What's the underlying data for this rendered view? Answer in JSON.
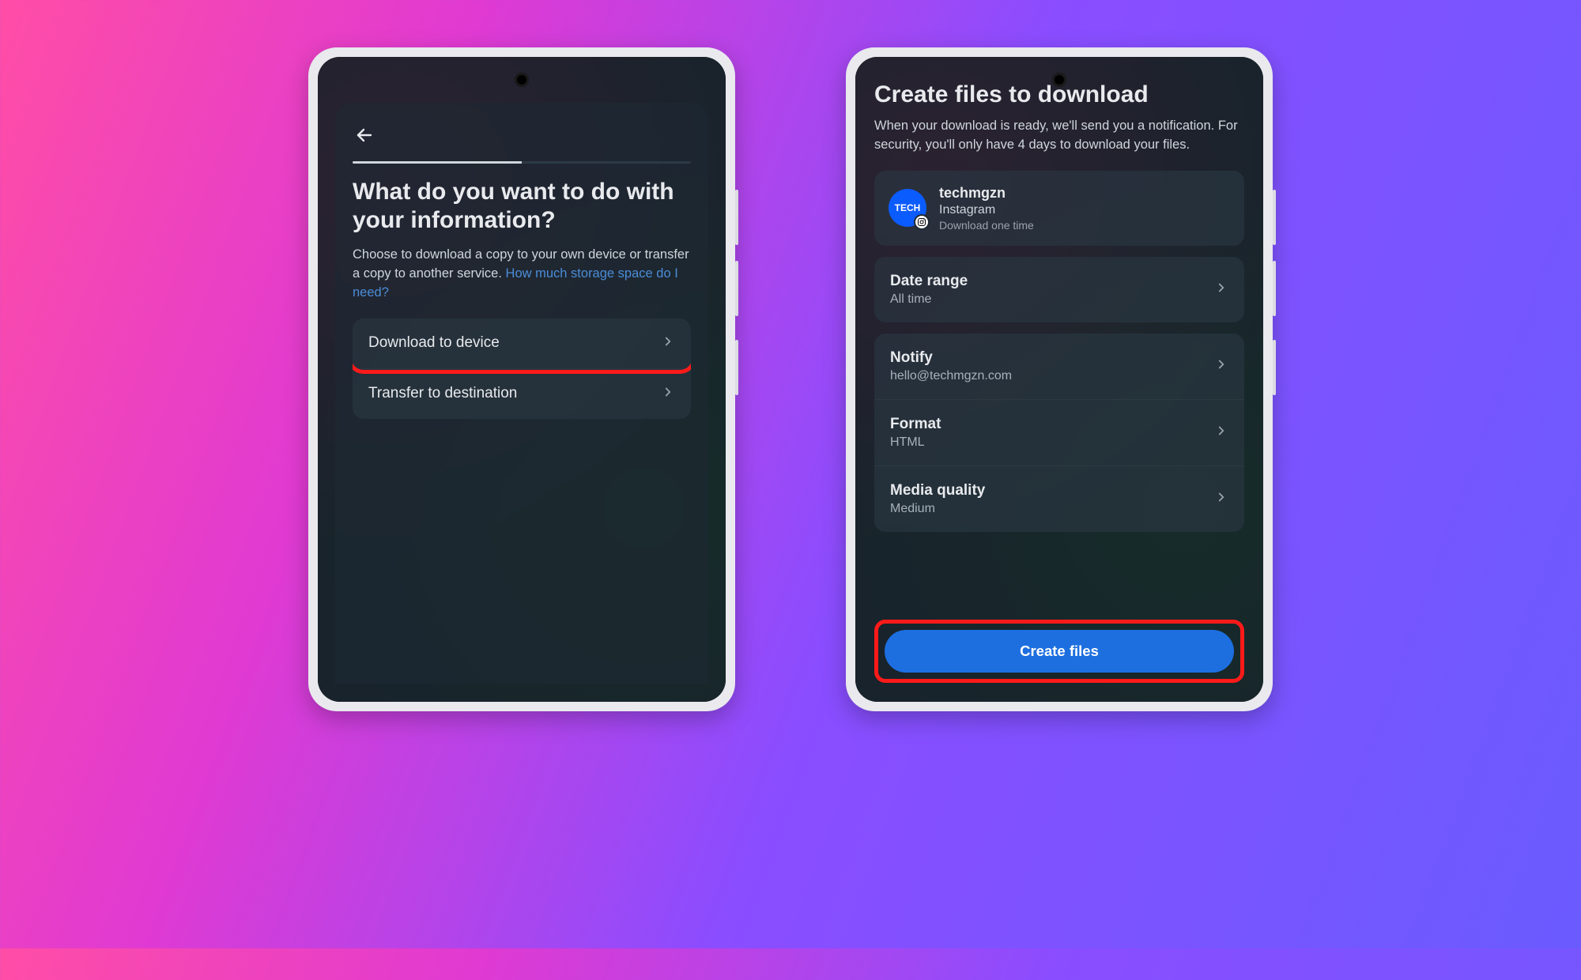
{
  "left": {
    "title": "What do you want to do with your information?",
    "subtitle_a": "Choose to download a copy to your own device or transfer a copy to another service. ",
    "storage_link": "How much storage space do I need?",
    "options": {
      "download": "Download to device",
      "transfer": "Transfer to destination"
    }
  },
  "right": {
    "title": "Create files to download",
    "subtitle": "When your download is ready, we'll send you a notification. For security, you'll only have 4 days to download your files.",
    "account": {
      "name": "techmgzn",
      "service": "Instagram",
      "note": "Download one time",
      "avatar_text": "TECH"
    },
    "rows": {
      "date_range_label": "Date range",
      "date_range_value": "All time",
      "notify_label": "Notify",
      "notify_value": "hello@techmgzn.com",
      "format_label": "Format",
      "format_value": "HTML",
      "media_label": "Media quality",
      "media_value": "Medium"
    },
    "cta": "Create files"
  }
}
